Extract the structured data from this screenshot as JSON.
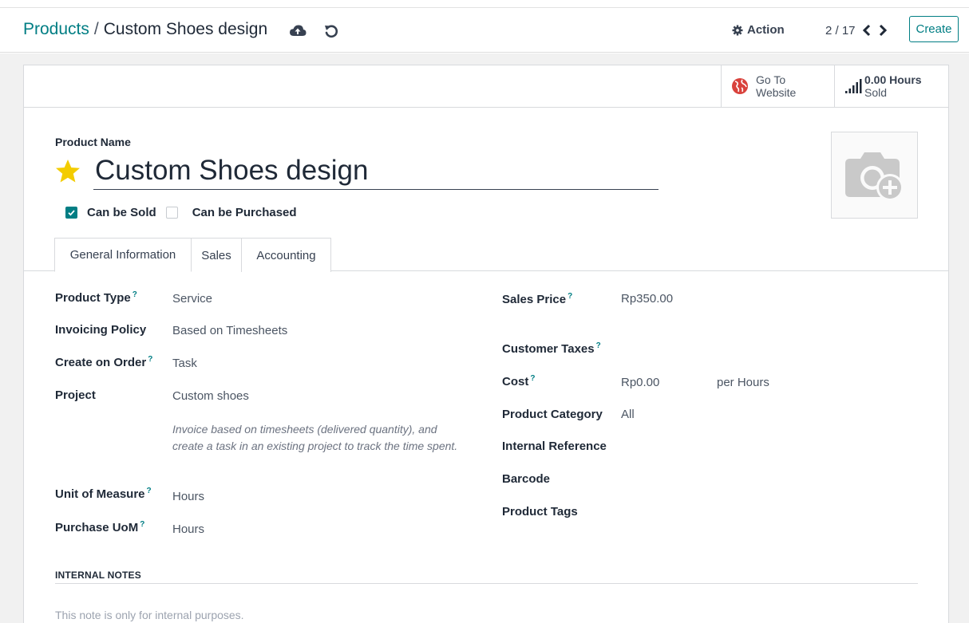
{
  "breadcrumb": {
    "parent": "Products",
    "separator": "/",
    "current": "Custom Shoes design"
  },
  "toolbar": {
    "save_icon": "cloud-upload-icon",
    "discard_icon": "undo-icon",
    "action_label": "Action",
    "action_icon": "gear-icon",
    "pager_value": "2 / 17",
    "create_label": "Create"
  },
  "smart_buttons": {
    "website": {
      "line1": "Go To",
      "line2": "Website",
      "icon": "globe-icon"
    },
    "hours_sold": {
      "value": "0.00 Hours",
      "label": "Sold",
      "icon": "signal-bars-icon"
    }
  },
  "product": {
    "name_label": "Product Name",
    "name": "Custom Shoes design",
    "favorite_icon": "star-icon",
    "can_be_sold_label": "Can be Sold",
    "can_be_sold": true,
    "can_be_purchased_label": "Can be Purchased",
    "can_be_purchased": false,
    "image_icon": "camera-plus-icon"
  },
  "tabs": [
    {
      "label": "General Information",
      "active": true
    },
    {
      "label": "Sales",
      "active": false
    },
    {
      "label": "Accounting",
      "active": false
    }
  ],
  "left_fields": {
    "product_type": {
      "label": "Product Type",
      "help": "?",
      "value": "Service"
    },
    "invoicing_policy": {
      "label": "Invoicing Policy",
      "value": "Based on Timesheets"
    },
    "create_on_order": {
      "label": "Create on Order",
      "help": "?",
      "value": "Task"
    },
    "project": {
      "label": "Project",
      "value": "Custom shoes"
    },
    "help_text": "Invoice based on timesheets (delivered quantity), and create a task in an existing project to track the time spent.",
    "unit_of_measure": {
      "label": "Unit of Measure",
      "help": "?",
      "value": "Hours"
    },
    "purchase_uom": {
      "label": "Purchase UoM",
      "help": "?",
      "value": "Hours"
    }
  },
  "right_fields": {
    "sales_price": {
      "label": "Sales Price",
      "help": "?",
      "value": "Rp350.00"
    },
    "customer_taxes": {
      "label": "Customer Taxes",
      "help": "?",
      "value": ""
    },
    "cost": {
      "label": "Cost",
      "help": "?",
      "value": "Rp0.00",
      "unit": "per Hours"
    },
    "product_category": {
      "label": "Product Category",
      "value": "All"
    },
    "internal_reference": {
      "label": "Internal Reference",
      "value": ""
    },
    "barcode": {
      "label": "Barcode",
      "value": ""
    },
    "product_tags": {
      "label": "Product Tags",
      "value": ""
    }
  },
  "notes": {
    "heading": "INTERNAL NOTES",
    "placeholder": "This note is only for internal purposes."
  },
  "colors": {
    "accent": "#017e84",
    "star": "#f3cc00",
    "globe": "#d9423c"
  }
}
